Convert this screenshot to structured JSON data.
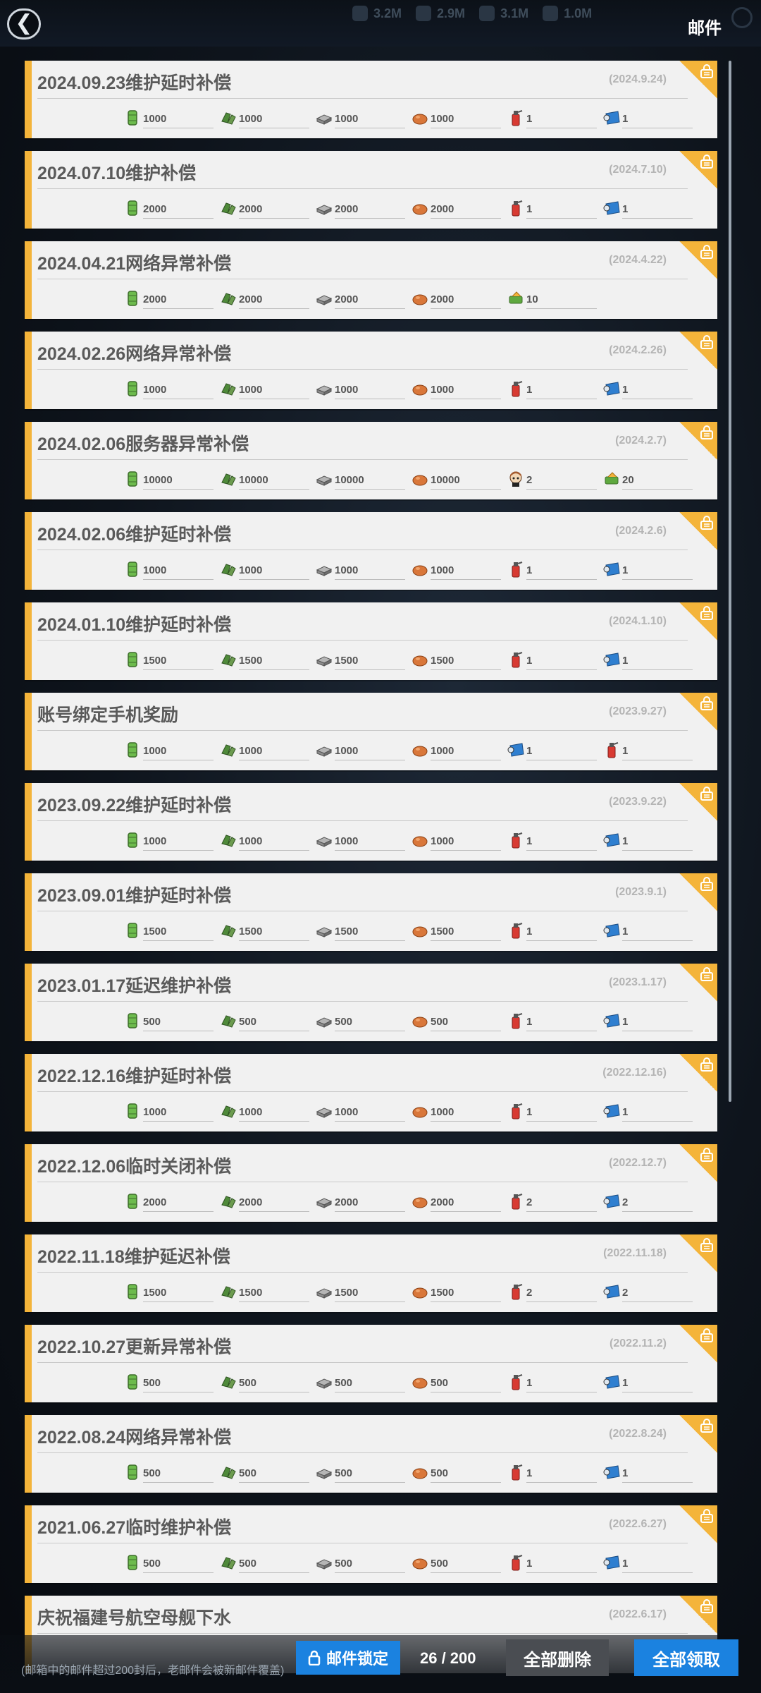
{
  "header": {
    "title": "邮件",
    "back_icon": "chevron-left-icon",
    "resources": [
      "3.2M",
      "2.9M",
      "3.1M",
      "1.0M"
    ]
  },
  "reward_icons": {
    "oil": {
      "name": "oil-barrel-icon",
      "color": "#6dbb4d"
    },
    "ammo": {
      "name": "ammo-icon",
      "color": "#4f8a3a"
    },
    "steel": {
      "name": "steel-icon",
      "color": "#8c8c8c"
    },
    "bauxite": {
      "name": "bauxite-icon",
      "color": "#d9773a"
    },
    "repair": {
      "name": "fast-repair-icon",
      "color": "#d83a32"
    },
    "blueprint": {
      "name": "blueprint-icon",
      "color": "#2f7fd0"
    },
    "food": {
      "name": "food-ticket-icon",
      "color": "#5fa93f"
    },
    "character": {
      "name": "character-icon",
      "color": "#a55a2e"
    }
  },
  "mails": [
    {
      "title": "2024.09.23维护延时补偿",
      "date": "(2024.9.24)",
      "rewards": [
        {
          "icon": "oil",
          "count": "1000"
        },
        {
          "icon": "ammo",
          "count": "1000"
        },
        {
          "icon": "steel",
          "count": "1000"
        },
        {
          "icon": "bauxite",
          "count": "1000"
        },
        {
          "icon": "repair",
          "count": "1"
        },
        {
          "icon": "blueprint",
          "count": "1"
        }
      ]
    },
    {
      "title": "2024.07.10维护补偿",
      "date": "(2024.7.10)",
      "rewards": [
        {
          "icon": "oil",
          "count": "2000"
        },
        {
          "icon": "ammo",
          "count": "2000"
        },
        {
          "icon": "steel",
          "count": "2000"
        },
        {
          "icon": "bauxite",
          "count": "2000"
        },
        {
          "icon": "repair",
          "count": "1"
        },
        {
          "icon": "blueprint",
          "count": "1"
        }
      ]
    },
    {
      "title": "2024.04.21网络异常补偿",
      "date": "(2024.4.22)",
      "rewards": [
        {
          "icon": "oil",
          "count": "2000"
        },
        {
          "icon": "ammo",
          "count": "2000"
        },
        {
          "icon": "steel",
          "count": "2000"
        },
        {
          "icon": "bauxite",
          "count": "2000"
        },
        {
          "icon": "food",
          "count": "10"
        }
      ]
    },
    {
      "title": "2024.02.26网络异常补偿",
      "date": "(2024.2.26)",
      "rewards": [
        {
          "icon": "oil",
          "count": "1000"
        },
        {
          "icon": "ammo",
          "count": "1000"
        },
        {
          "icon": "steel",
          "count": "1000"
        },
        {
          "icon": "bauxite",
          "count": "1000"
        },
        {
          "icon": "repair",
          "count": "1"
        },
        {
          "icon": "blueprint",
          "count": "1"
        }
      ]
    },
    {
      "title": "2024.02.06服务器异常补偿",
      "date": "(2024.2.7)",
      "rewards": [
        {
          "icon": "oil",
          "count": "10000"
        },
        {
          "icon": "ammo",
          "count": "10000"
        },
        {
          "icon": "steel",
          "count": "10000"
        },
        {
          "icon": "bauxite",
          "count": "10000"
        },
        {
          "icon": "character",
          "count": "2"
        },
        {
          "icon": "food",
          "count": "20"
        }
      ]
    },
    {
      "title": "2024.02.06维护延时补偿",
      "date": "(2024.2.6)",
      "rewards": [
        {
          "icon": "oil",
          "count": "1000"
        },
        {
          "icon": "ammo",
          "count": "1000"
        },
        {
          "icon": "steel",
          "count": "1000"
        },
        {
          "icon": "bauxite",
          "count": "1000"
        },
        {
          "icon": "repair",
          "count": "1"
        },
        {
          "icon": "blueprint",
          "count": "1"
        }
      ]
    },
    {
      "title": "2024.01.10维护延时补偿",
      "date": "(2024.1.10)",
      "rewards": [
        {
          "icon": "oil",
          "count": "1500"
        },
        {
          "icon": "ammo",
          "count": "1500"
        },
        {
          "icon": "steel",
          "count": "1500"
        },
        {
          "icon": "bauxite",
          "count": "1500"
        },
        {
          "icon": "repair",
          "count": "1"
        },
        {
          "icon": "blueprint",
          "count": "1"
        }
      ]
    },
    {
      "title": "账号绑定手机奖励",
      "date": "(2023.9.27)",
      "rewards": [
        {
          "icon": "oil",
          "count": "1000"
        },
        {
          "icon": "ammo",
          "count": "1000"
        },
        {
          "icon": "steel",
          "count": "1000"
        },
        {
          "icon": "bauxite",
          "count": "1000"
        },
        {
          "icon": "blueprint",
          "count": "1"
        },
        {
          "icon": "repair",
          "count": "1"
        }
      ]
    },
    {
      "title": "2023.09.22维护延时补偿",
      "date": "(2023.9.22)",
      "rewards": [
        {
          "icon": "oil",
          "count": "1000"
        },
        {
          "icon": "ammo",
          "count": "1000"
        },
        {
          "icon": "steel",
          "count": "1000"
        },
        {
          "icon": "bauxite",
          "count": "1000"
        },
        {
          "icon": "repair",
          "count": "1"
        },
        {
          "icon": "blueprint",
          "count": "1"
        }
      ]
    },
    {
      "title": "2023.09.01维护延时补偿",
      "date": "(2023.9.1)",
      "rewards": [
        {
          "icon": "oil",
          "count": "1500"
        },
        {
          "icon": "ammo",
          "count": "1500"
        },
        {
          "icon": "steel",
          "count": "1500"
        },
        {
          "icon": "bauxite",
          "count": "1500"
        },
        {
          "icon": "repair",
          "count": "1"
        },
        {
          "icon": "blueprint",
          "count": "1"
        }
      ]
    },
    {
      "title": "2023.01.17延迟维护补偿",
      "date": "(2023.1.17)",
      "rewards": [
        {
          "icon": "oil",
          "count": "500"
        },
        {
          "icon": "ammo",
          "count": "500"
        },
        {
          "icon": "steel",
          "count": "500"
        },
        {
          "icon": "bauxite",
          "count": "500"
        },
        {
          "icon": "repair",
          "count": "1"
        },
        {
          "icon": "blueprint",
          "count": "1"
        }
      ]
    },
    {
      "title": "2022.12.16维护延时补偿",
      "date": "(2022.12.16)",
      "rewards": [
        {
          "icon": "oil",
          "count": "1000"
        },
        {
          "icon": "ammo",
          "count": "1000"
        },
        {
          "icon": "steel",
          "count": "1000"
        },
        {
          "icon": "bauxite",
          "count": "1000"
        },
        {
          "icon": "repair",
          "count": "1"
        },
        {
          "icon": "blueprint",
          "count": "1"
        }
      ]
    },
    {
      "title": "2022.12.06临时关闭补偿",
      "date": "(2022.12.7)",
      "rewards": [
        {
          "icon": "oil",
          "count": "2000"
        },
        {
          "icon": "ammo",
          "count": "2000"
        },
        {
          "icon": "steel",
          "count": "2000"
        },
        {
          "icon": "bauxite",
          "count": "2000"
        },
        {
          "icon": "repair",
          "count": "2"
        },
        {
          "icon": "blueprint",
          "count": "2"
        }
      ]
    },
    {
      "title": "2022.11.18维护延迟补偿",
      "date": "(2022.11.18)",
      "rewards": [
        {
          "icon": "oil",
          "count": "1500"
        },
        {
          "icon": "ammo",
          "count": "1500"
        },
        {
          "icon": "steel",
          "count": "1500"
        },
        {
          "icon": "bauxite",
          "count": "1500"
        },
        {
          "icon": "repair",
          "count": "2"
        },
        {
          "icon": "blueprint",
          "count": "2"
        }
      ]
    },
    {
      "title": "2022.10.27更新异常补偿",
      "date": "(2022.11.2)",
      "rewards": [
        {
          "icon": "oil",
          "count": "500"
        },
        {
          "icon": "ammo",
          "count": "500"
        },
        {
          "icon": "steel",
          "count": "500"
        },
        {
          "icon": "bauxite",
          "count": "500"
        },
        {
          "icon": "repair",
          "count": "1"
        },
        {
          "icon": "blueprint",
          "count": "1"
        }
      ]
    },
    {
      "title": "2022.08.24网络异常补偿",
      "date": "(2022.8.24)",
      "rewards": [
        {
          "icon": "oil",
          "count": "500"
        },
        {
          "icon": "ammo",
          "count": "500"
        },
        {
          "icon": "steel",
          "count": "500"
        },
        {
          "icon": "bauxite",
          "count": "500"
        },
        {
          "icon": "repair",
          "count": "1"
        },
        {
          "icon": "blueprint",
          "count": "1"
        }
      ]
    },
    {
      "title": "2021.06.27临时维护补偿",
      "date": "(2022.6.27)",
      "rewards": [
        {
          "icon": "oil",
          "count": "500"
        },
        {
          "icon": "ammo",
          "count": "500"
        },
        {
          "icon": "steel",
          "count": "500"
        },
        {
          "icon": "bauxite",
          "count": "500"
        },
        {
          "icon": "repair",
          "count": "1"
        },
        {
          "icon": "blueprint",
          "count": "1"
        }
      ]
    },
    {
      "title": "庆祝福建号航空母舰下水",
      "date": "(2022.6.17)",
      "rewards": []
    }
  ],
  "footer": {
    "notice": "(邮箱中的邮件超过200封后，老邮件会被新邮件覆盖)",
    "lock_label": "邮件锁定",
    "counter": "26 / 200",
    "delete_all_label": "全部删除",
    "claim_all_label": "全部领取"
  }
}
